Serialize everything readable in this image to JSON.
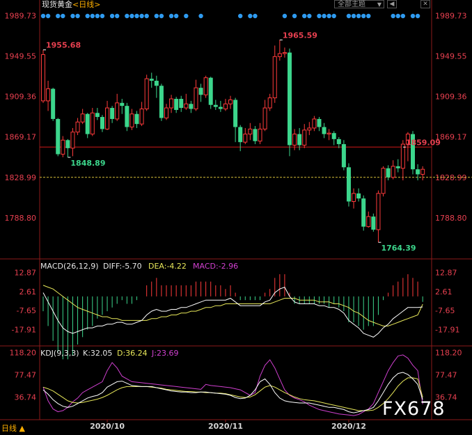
{
  "header": {
    "title": "现货黄金",
    "period": "<日线>",
    "theme_label": "全部主题",
    "theme_arrow": "▼",
    "tool_left": "◀",
    "tool_right": "✕"
  },
  "footer": {
    "period_label": "日线 ▲",
    "watermark": "FX678"
  },
  "colors": {
    "up": "#ff3b3b",
    "down": "#3cd68c",
    "axis_label": "#e84050",
    "macd_dea": "#e8e85a",
    "macd_macd": "#d040d0",
    "kdj_k": "#ffffff",
    "kdj_d": "#e8e85a",
    "kdj_j": "#d040d0",
    "event_dot": "#2f9bf0",
    "month_label": "#d8d8d8"
  },
  "chart_data": {
    "type": "candlestick",
    "price_panel": {
      "y_ticks": [
        "1989.73",
        "1949.55",
        "1909.36",
        "1869.17",
        "1828.99",
        "1788.80"
      ],
      "y_tick_values": [
        1989.73,
        1949.55,
        1909.36,
        1869.17,
        1828.99,
        1788.8
      ],
      "ylim": [
        1749.3,
        1993.5
      ],
      "annotations": [
        {
          "text": "1955.68",
          "index": 0,
          "value": 1955.68,
          "kind": "high"
        },
        {
          "text": "1848.89",
          "index": 5,
          "value": 1848.89,
          "kind": "low"
        },
        {
          "text": "1965.59",
          "index": 48,
          "value": 1965.59,
          "kind": "high"
        },
        {
          "text": "1764.39",
          "index": 68,
          "value": 1764.39,
          "kind": "low"
        },
        {
          "text": "1859.09",
          "index": 73,
          "value": 1859.09,
          "kind": "level"
        }
      ],
      "horizontal_level": 1859.09,
      "last_price_level": 1828.99,
      "candles": [
        [
          1905,
          1951,
          1955.68,
          1903
        ],
        [
          1905,
          1917,
          1925,
          1895
        ],
        [
          1917,
          1887,
          1918,
          1885
        ],
        [
          1887,
          1852,
          1888,
          1850
        ],
        [
          1852,
          1866,
          1870,
          1849
        ],
        [
          1866,
          1858,
          1867,
          1848.89
        ],
        [
          1858,
          1874,
          1878,
          1850
        ],
        [
          1874,
          1884,
          1888,
          1871
        ],
        [
          1884,
          1892,
          1897,
          1882
        ],
        [
          1892,
          1872,
          1893,
          1868
        ],
        [
          1872,
          1893,
          1898,
          1870
        ],
        [
          1893,
          1889,
          1898,
          1886
        ],
        [
          1889,
          1877,
          1891,
          1874
        ],
        [
          1877,
          1898,
          1905,
          1876
        ],
        [
          1898,
          1887,
          1900,
          1883
        ],
        [
          1887,
          1903,
          1912,
          1885
        ],
        [
          1903,
          1900,
          1907,
          1892
        ],
        [
          1900,
          1879,
          1903,
          1875
        ],
        [
          1879,
          1892,
          1897,
          1876
        ],
        [
          1892,
          1882,
          1895,
          1878
        ],
        [
          1882,
          1897,
          1904,
          1880
        ],
        [
          1897,
          1927,
          1931,
          1895
        ],
        [
          1927,
          1925,
          1933,
          1918
        ],
        [
          1925,
          1920,
          1930,
          1908
        ],
        [
          1920,
          1888,
          1922,
          1885
        ],
        [
          1888,
          1898,
          1902,
          1886
        ],
        [
          1898,
          1907,
          1911,
          1893
        ],
        [
          1907,
          1896,
          1909,
          1893
        ],
        [
          1907,
          1898,
          1910,
          1894
        ],
        [
          1898,
          1902,
          1912,
          1896
        ],
        [
          1902,
          1897,
          1905,
          1893
        ],
        [
          1897,
          1918,
          1926,
          1895
        ],
        [
          1918,
          1911,
          1922,
          1904
        ],
        [
          1911,
          1928,
          1930,
          1908
        ],
        [
          1928,
          1901,
          1929,
          1897
        ],
        [
          1901,
          1899,
          1906,
          1896
        ],
        [
          1899,
          1897,
          1905,
          1894
        ],
        [
          1897,
          1902,
          1907,
          1895
        ],
        [
          1902,
          1906,
          1910,
          1897
        ],
        [
          1906,
          1879,
          1908,
          1864
        ],
        [
          1879,
          1864,
          1881,
          1855
        ],
        [
          1864,
          1872,
          1878,
          1862
        ],
        [
          1872,
          1877,
          1883,
          1866
        ],
        [
          1877,
          1865,
          1880,
          1862
        ],
        [
          1865,
          1877,
          1883,
          1862
        ],
        [
          1877,
          1898,
          1906,
          1875
        ],
        [
          1898,
          1908,
          1912,
          1895
        ],
        [
          1908,
          1949,
          1960,
          1903
        ],
        [
          1949,
          1952,
          1965.59,
          1945
        ],
        [
          1952,
          1953,
          1958,
          1948
        ],
        [
          1953,
          1861,
          1957,
          1850
        ],
        [
          1861,
          1872,
          1877,
          1856
        ],
        [
          1872,
          1861,
          1878,
          1856
        ],
        [
          1861,
          1876,
          1882,
          1858
        ],
        [
          1876,
          1878,
          1884,
          1871
        ],
        [
          1878,
          1887,
          1890,
          1875
        ],
        [
          1887,
          1879,
          1889,
          1875
        ],
        [
          1879,
          1872,
          1883,
          1868
        ],
        [
          1872,
          1873,
          1877,
          1866
        ],
        [
          1873,
          1867,
          1875,
          1861
        ],
        [
          1867,
          1862,
          1869,
          1858
        ],
        [
          1862,
          1839,
          1866,
          1836
        ],
        [
          1839,
          1805,
          1843,
          1800
        ],
        [
          1805,
          1813,
          1818,
          1798
        ],
        [
          1813,
          1808,
          1818,
          1805
        ],
        [
          1808,
          1780,
          1811,
          1776
        ],
        [
          1780,
          1790,
          1795,
          1779
        ],
        [
          1790,
          1777,
          1793,
          1775
        ],
        [
          1777,
          1813,
          1816,
          1764.39
        ],
        [
          1813,
          1838,
          1840,
          1810
        ],
        [
          1838,
          1829,
          1841,
          1826
        ],
        [
          1829,
          1840,
          1846,
          1827
        ],
        [
          1840,
          1838,
          1847,
          1834
        ],
        [
          1838,
          1862,
          1866,
          1826
        ],
        [
          1862,
          1872,
          1874,
          1845
        ],
        [
          1872,
          1837,
          1875,
          1832
        ],
        [
          1837,
          1832,
          1842,
          1826
        ],
        [
          1832,
          1837,
          1840,
          1826
        ]
      ],
      "event_dot_indices": [
        0,
        1,
        3,
        4,
        6,
        7,
        9,
        10,
        11,
        12,
        14,
        15,
        17,
        18,
        19,
        20,
        21,
        23,
        24,
        26,
        27,
        29,
        32,
        40,
        42,
        43,
        49,
        51,
        53,
        54,
        56,
        57,
        58,
        59,
        62,
        63,
        64,
        65,
        66,
        71,
        72,
        73,
        75,
        76
      ]
    },
    "macd_panel": {
      "label_name": "MACD(26,12,9)",
      "diff_label": "DIFF:-5.70",
      "dea_label": "DEA:-4.22",
      "macd_label": "MACD:-2.96",
      "y_ticks": [
        "12.87",
        "2.61",
        "-7.65",
        "-17.91"
      ],
      "y_tick_values": [
        12.87,
        2.61,
        -7.65,
        -17.91
      ],
      "ylim": [
        -26,
        18
      ],
      "diff": [
        2,
        -3,
        -8,
        -13,
        -17,
        -19,
        -20,
        -19,
        -18,
        -17,
        -17,
        -16,
        -16,
        -15,
        -15,
        -14,
        -14,
        -15,
        -15,
        -14,
        -13,
        -10,
        -8,
        -7,
        -8,
        -8,
        -7,
        -7,
        -6,
        -6,
        -5,
        -4,
        -3,
        -2,
        -2,
        -2,
        -2,
        -2,
        -1,
        -3,
        -5,
        -5,
        -5,
        -5,
        -5,
        -3,
        -2,
        2,
        4,
        5,
        0,
        -3,
        -4,
        -4,
        -4,
        -4,
        -5,
        -5,
        -6,
        -6,
        -7,
        -9,
        -13,
        -15,
        -17,
        -20,
        -21,
        -22,
        -20,
        -17,
        -15,
        -12,
        -10,
        -8,
        -6,
        -6,
        -6,
        -5.7
      ],
      "dea": [
        6,
        5,
        4,
        2,
        0,
        -2,
        -4,
        -6,
        -7,
        -8,
        -9,
        -10,
        -11,
        -11,
        -12,
        -12,
        -13,
        -13,
        -13,
        -13,
        -13,
        -13,
        -12,
        -12,
        -11,
        -11,
        -10,
        -10,
        -9,
        -9,
        -8,
        -8,
        -7,
        -6,
        -6,
        -5,
        -5,
        -4,
        -4,
        -4,
        -4,
        -4,
        -4,
        -4,
        -4,
        -4,
        -4,
        -3,
        -2,
        -1,
        -1,
        -1,
        -2,
        -2,
        -2,
        -2,
        -3,
        -3,
        -3,
        -4,
        -4,
        -5,
        -6,
        -8,
        -9,
        -11,
        -13,
        -14,
        -15,
        -16,
        -16,
        -15,
        -14,
        -13,
        -12,
        -11,
        -10,
        -4.22
      ],
      "macd": [
        -8,
        -16,
        -24,
        -30,
        -34,
        -34,
        -32,
        -26,
        -22,
        -18,
        -16,
        -12,
        -10,
        -8,
        -6,
        -4,
        -2,
        -4,
        -4,
        -2,
        0,
        6,
        8,
        10,
        6,
        6,
        6,
        6,
        6,
        6,
        6,
        8,
        8,
        8,
        8,
        6,
        6,
        4,
        6,
        2,
        -2,
        -2,
        -2,
        -2,
        -2,
        2,
        4,
        10,
        12,
        12,
        2,
        -4,
        -4,
        -4,
        -4,
        -4,
        -4,
        -4,
        -6,
        -4,
        -6,
        -8,
        -14,
        -14,
        -16,
        -18,
        -16,
        -16,
        -10,
        -2,
        2,
        6,
        8,
        10,
        12,
        10,
        8,
        -2.96
      ]
    },
    "kdj_panel": {
      "label_name": "KDJ(9,3,3)",
      "k_label": "K:32.05",
      "d_label": "D:36.24",
      "j_label": "J:23.69",
      "y_ticks": [
        "118.20",
        "77.47",
        "36.74"
      ],
      "y_tick_values": [
        118.2,
        77.47,
        36.74
      ],
      "ylim": [
        -2,
        124
      ],
      "k": [
        50,
        42,
        32,
        25,
        20,
        18,
        20,
        25,
        30,
        35,
        38,
        40,
        45,
        55,
        60,
        65,
        66,
        62,
        58,
        57,
        56,
        56,
        56,
        54,
        52,
        50,
        48,
        47,
        46,
        46,
        45,
        45,
        46,
        46,
        45,
        44,
        43,
        42,
        40,
        36,
        34,
        35,
        40,
        50,
        65,
        70,
        60,
        45,
        35,
        30,
        28,
        27,
        26,
        26,
        26,
        24,
        22,
        20,
        18,
        18,
        16,
        14,
        10,
        8,
        10,
        12,
        14,
        18,
        30,
        45,
        60,
        72,
        80,
        82,
        78,
        70,
        60,
        32.05
      ],
      "d": [
        55,
        52,
        48,
        42,
        36,
        30,
        27,
        26,
        27,
        29,
        31,
        33,
        36,
        40,
        45,
        50,
        54,
        56,
        56,
        56,
        56,
        56,
        55,
        54,
        53,
        51,
        50,
        49,
        48,
        47,
        47,
        46,
        46,
        45,
        45,
        44,
        44,
        43,
        41,
        39,
        37,
        36,
        37,
        41,
        48,
        55,
        58,
        55,
        50,
        45,
        41,
        37,
        34,
        32,
        31,
        30,
        28,
        26,
        24,
        22,
        20,
        18,
        16,
        14,
        12,
        12,
        12,
        13,
        18,
        25,
        34,
        45,
        57,
        66,
        72,
        72,
        70,
        36.24
      ],
      "j": [
        55,
        30,
        15,
        10,
        12,
        18,
        28,
        35,
        45,
        50,
        55,
        60,
        65,
        85,
        100,
        90,
        75,
        70,
        65,
        64,
        63,
        62,
        61,
        60,
        59,
        58,
        57,
        56,
        55,
        54,
        53,
        52,
        51,
        60,
        58,
        57,
        56,
        55,
        54,
        52,
        50,
        45,
        40,
        45,
        75,
        95,
        105,
        90,
        70,
        50,
        40,
        35,
        32,
        28,
        22,
        18,
        14,
        12,
        10,
        8,
        6,
        5,
        4,
        3,
        5,
        10,
        15,
        25,
        45,
        65,
        85,
        100,
        112,
        114,
        108,
        95,
        85,
        23.69
      ]
    },
    "x_ticks": [
      {
        "label": "2020/10",
        "index": 13
      },
      {
        "label": "2020/11",
        "index": 37
      },
      {
        "label": "2020/12",
        "index": 62
      }
    ]
  }
}
